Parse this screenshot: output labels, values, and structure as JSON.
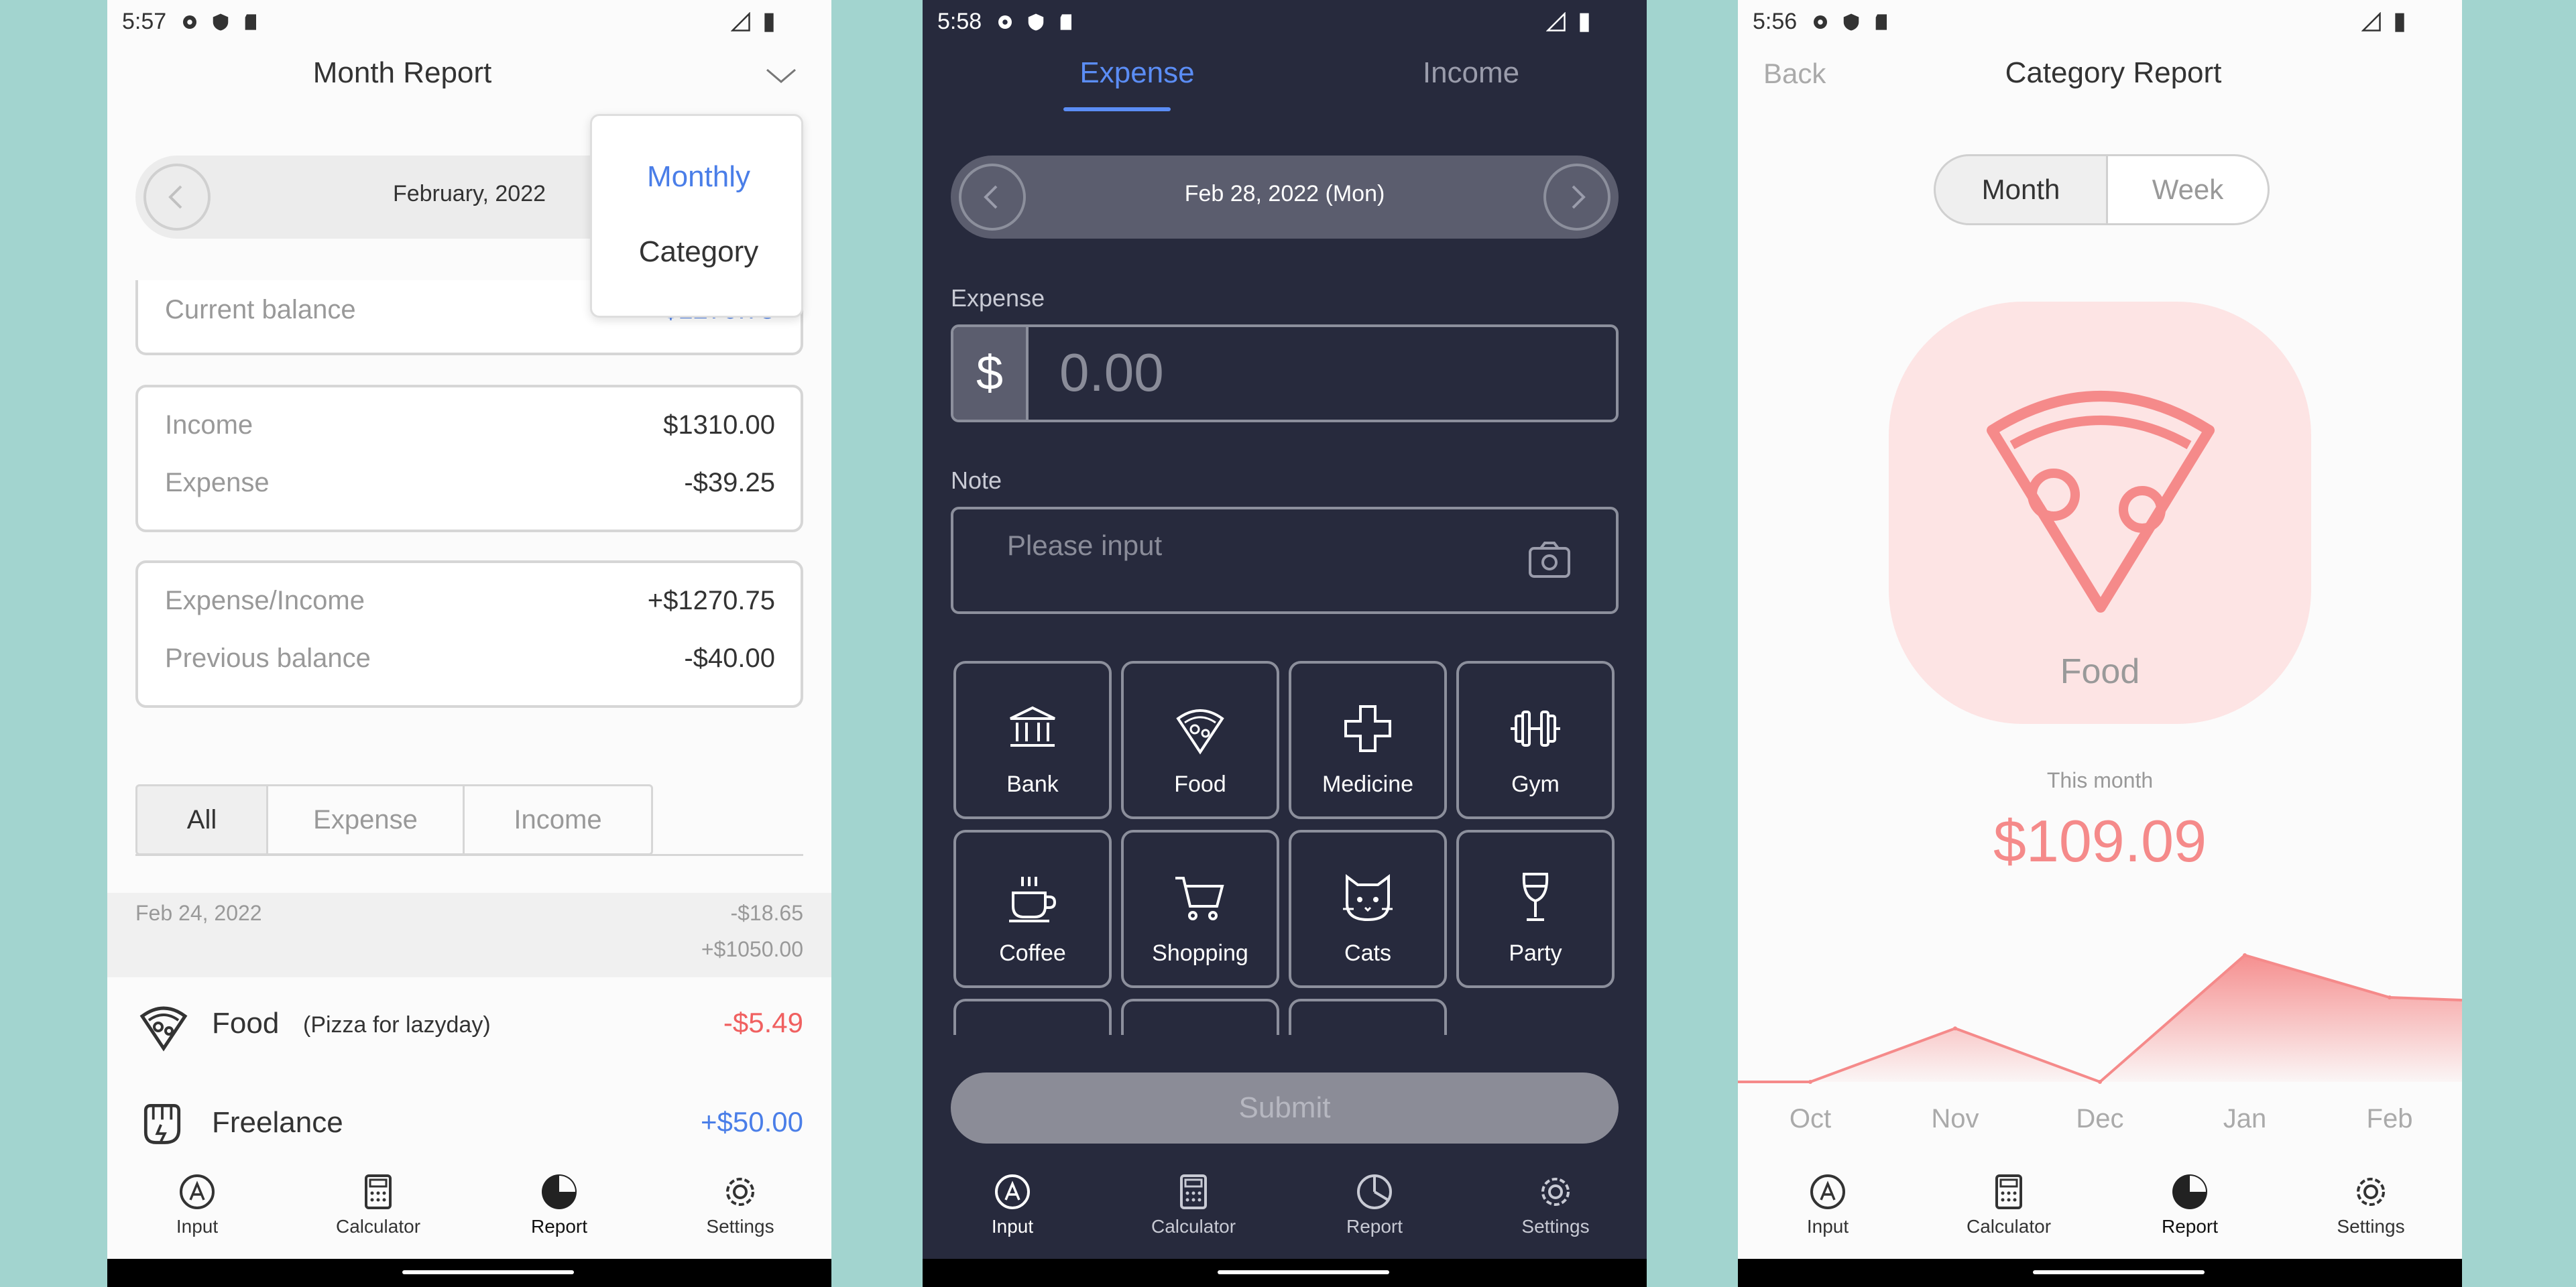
{
  "colors": {
    "teal_bg": "#a2d4cf",
    "accent_blue": "#4a7ee8",
    "red": "#f06060",
    "pink_bg": "#fde4e4",
    "pink": "#f58a8a",
    "dark_bg": "#272a3d"
  },
  "phone1": {
    "status_time": "5:57",
    "title": "Month Report",
    "month_label": "February, 2022",
    "dropdown": {
      "options": [
        "Monthly",
        "Category"
      ],
      "selected": "Monthly"
    },
    "current_balance_label": "Current balance",
    "current_balance_value": "$1270.75",
    "income_label": "Income",
    "income_value": "$1310.00",
    "expense_label": "Expense",
    "expense_value": "-$39.25",
    "exp_income_label": "Expense/Income",
    "exp_income_value": "+$1270.75",
    "prev_balance_label": "Previous balance",
    "prev_balance_value": "-$40.00",
    "tabs": [
      "All",
      "Expense",
      "Income"
    ],
    "group_date": "Feb 24, 2022",
    "group_expense": "-$18.65",
    "group_income": "+$1050.00",
    "entries": [
      {
        "name": "Food",
        "note": "(Pizza for lazyday)",
        "amount": "-$5.49",
        "icon": "pizza-icon"
      },
      {
        "name": "Freelance",
        "note": "",
        "amount": "+$50.00",
        "icon": "fist-icon"
      }
    ]
  },
  "phone2": {
    "status_time": "5:58",
    "tabs": [
      "Expense",
      "Income"
    ],
    "date_label": "Feb 28, 2022 (Mon)",
    "expense_label": "Expense",
    "currency": "$",
    "amount_placeholder": "0.00",
    "note_label": "Note",
    "note_placeholder": "Please input",
    "categories": [
      {
        "label": "Bank",
        "icon": "bank-icon"
      },
      {
        "label": "Food",
        "icon": "pizza-icon"
      },
      {
        "label": "Medicine",
        "icon": "cross-icon"
      },
      {
        "label": "Gym",
        "icon": "dumbbell-icon"
      },
      {
        "label": "Coffee",
        "icon": "coffee-icon"
      },
      {
        "label": "Shopping",
        "icon": "cart-icon"
      },
      {
        "label": "Cats",
        "icon": "cat-icon"
      },
      {
        "label": "Party",
        "icon": "wine-icon"
      }
    ],
    "submit_label": "Submit"
  },
  "phone3": {
    "status_time": "5:56",
    "back_label": "Back",
    "title": "Category Report",
    "segments": [
      "Month",
      "Week"
    ],
    "category_name": "Food",
    "this_month_label": "This month",
    "this_month_value": "$109.09",
    "chart_data": {
      "type": "area",
      "categories": [
        "Oct",
        "Nov",
        "Dec",
        "Jan",
        "Feb"
      ],
      "values": [
        0,
        38,
        0,
        90,
        60
      ],
      "ylim": [
        0,
        100
      ],
      "grid": false,
      "color": "#f58a8a"
    }
  },
  "nav": {
    "input": "Input",
    "calculator": "Calculator",
    "report": "Report",
    "settings": "Settings"
  }
}
